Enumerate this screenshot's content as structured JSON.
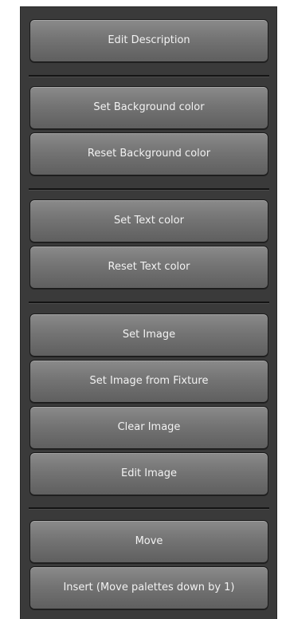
{
  "menu": {
    "edit_description": "Edit Description",
    "set_background_color": "Set Background color",
    "reset_background_color": "Reset Background color",
    "set_text_color": "Set Text color",
    "reset_text_color": "Reset Text color",
    "set_image": "Set Image",
    "set_image_from_fixture": "Set Image from Fixture",
    "clear_image": "Clear Image",
    "edit_image": "Edit Image",
    "move": "Move",
    "insert": "Insert (Move palettes down by 1)"
  },
  "colors": {
    "panel_background": "#3a3a3a",
    "button_top": "#8a8a8a",
    "button_bottom": "#5f5f5f",
    "separator": "#141414",
    "text": "#f2f2f2"
  }
}
